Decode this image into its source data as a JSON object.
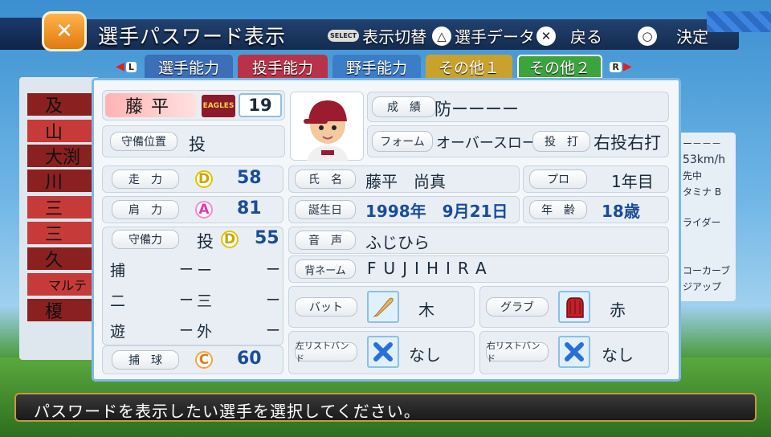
{
  "header": {
    "title": "選手パスワード表示",
    "logo_icon": "crossed-bats-icon",
    "buttons": [
      {
        "icon": "SELECT",
        "label": "表示切替"
      },
      {
        "icon": "△",
        "label": "選手データ"
      },
      {
        "icon": "✕",
        "label": "戻る"
      },
      {
        "icon": "○",
        "label": "決定"
      }
    ]
  },
  "tabs": {
    "left_button": "L",
    "right_button": "R",
    "items": [
      {
        "label": "選手能力",
        "color": "#3c6fb8"
      },
      {
        "label": "投手能力",
        "color": "#b8334a"
      },
      {
        "label": "野手能力",
        "color": "#3c7dc8"
      },
      {
        "label": "その他１",
        "color": "#c9a22e"
      },
      {
        "label": "その他２",
        "color": "#3ca43c"
      }
    ],
    "active": "その他２"
  },
  "sidebar": {
    "items": [
      "及",
      "山",
      "大渕",
      "川",
      "三",
      "三",
      "久",
      "マルテ",
      "榎"
    ]
  },
  "right_panel": {
    "lines": [
      "ー－－－",
      "53km/h",
      "先中",
      "タミナ B",
      "ライダー",
      "コーカーブ",
      "ジアップ"
    ]
  },
  "player": {
    "name": "藤平",
    "team_logo": "EAGLES",
    "number": "19",
    "position_label": "守備位置",
    "position": "投",
    "record_label": "成　績",
    "record": "防ーーーー",
    "form_label": "フォーム",
    "form": "オーバースロー９",
    "bat_throw_label": "投　打",
    "bat_throw": "右投右打"
  },
  "abilities": {
    "speed": {
      "label": "走　力",
      "grade": "D",
      "value": "58"
    },
    "arm": {
      "label": "肩　力",
      "grade": "A",
      "value": "81"
    },
    "fielding": {
      "label": "守備力",
      "position": "投",
      "grade": "D",
      "value": "55"
    },
    "sub_positions": [
      {
        "pos": "捕",
        "dash": "ー"
      },
      {
        "pos": "ー",
        "dash": "ー"
      },
      {
        "pos": "二",
        "dash": "ー"
      },
      {
        "pos": "三",
        "dash": "ー"
      },
      {
        "pos": "遊",
        "dash": "ー"
      },
      {
        "pos": "外",
        "dash": "ー"
      }
    ],
    "catching": {
      "label": "捕　球",
      "grade": "C",
      "value": "60"
    }
  },
  "profile": {
    "fullname_label": "氏　名",
    "fullname": "藤平　尚真",
    "birthday_label": "誕生日",
    "birthday": "1998年　9月21日",
    "voice_label": "音　声",
    "voice": "ふじひら",
    "back_name_label": "背ネーム",
    "back_name": "FUJIHIRA",
    "pro_label": "プロ",
    "pro_years": "1年目",
    "age_label": "年　齢",
    "age": "18歳"
  },
  "equipment": {
    "bat_label": "バット",
    "bat": "木",
    "glove_label": "グラブ",
    "glove": "赤",
    "left_wristband_label": "左リストバンド",
    "left_wristband": "なし",
    "right_wristband_label": "右リストバンド",
    "right_wristband": "なし"
  },
  "message": "パスワードを表示したい選手を選択してください。"
}
